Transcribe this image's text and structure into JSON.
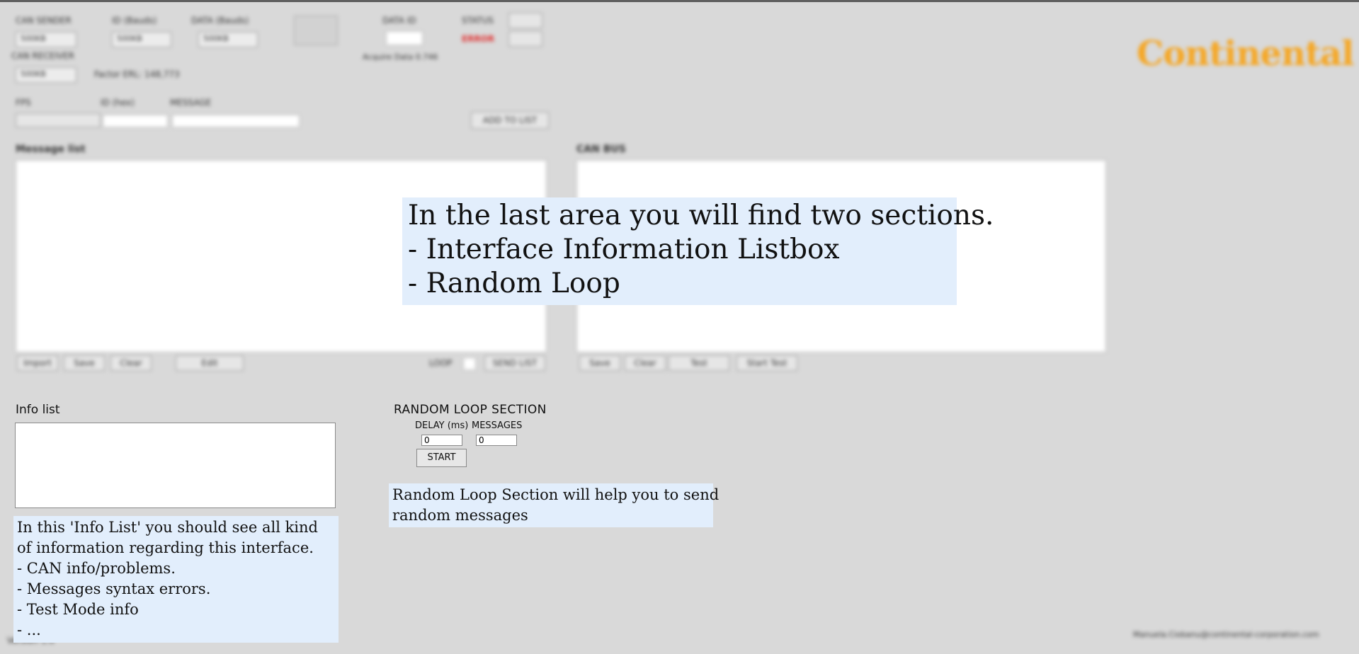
{
  "header": {
    "can_sender_label": "CAN SENDER",
    "id_label": "ID (Bauds)",
    "data_label": "DATA (Bauds)",
    "dataid_label": "DATA ID",
    "status_label": "STATUS",
    "status_value": "ERROR",
    "can_receiver_label": "CAN RECEIVER",
    "select_value": "500KB",
    "factor_text": "Factor ERL: 148,773",
    "acquire_text": "Acquire Data 0.746",
    "logo_text": "Continental"
  },
  "editor": {
    "fields_label": "FPS",
    "id_label": "ID (hex)",
    "message_label": "MESSAGE",
    "add_button": "ADD TO LIST"
  },
  "message_list": {
    "title": "Message list",
    "buttons": [
      "Import",
      "Save",
      "Clear",
      "Edit"
    ],
    "loop_label": "LOOP",
    "send_label": "SEND LIST"
  },
  "can_bus": {
    "title": "CAN BUS",
    "buttons": [
      "Save",
      "Clear",
      "Test",
      "Start Test"
    ]
  },
  "info_list": {
    "title": "Info list"
  },
  "random_loop": {
    "title": "RANDOM LOOP SECTION",
    "delay_label": "DELAY (ms)",
    "messages_label": "MESSAGES",
    "delay_value": "0",
    "messages_value": "0",
    "start_label": "START"
  },
  "notes": {
    "main": [
      "In the last area you will find two sections.",
      "- Interface Information Listbox",
      "- Random Loop"
    ],
    "random": [
      "Random Loop Section will help you to send",
      "random messages"
    ],
    "info": [
      "In this 'Info List' you should see all kind",
      "of information regarding this interface.",
      "- CAN info/problems.",
      "- Messages syntax errors.",
      "- Test Mode info",
      "- ..."
    ]
  },
  "footer": {
    "left_text": "Version 1.0",
    "right_text": "Manuela.Ciobanu@continental-corporation.com"
  },
  "colors": {
    "background": "#d9d9d9",
    "note_background": "#e2eefc",
    "logo": "#f5a623",
    "status_error": "#e03030"
  }
}
